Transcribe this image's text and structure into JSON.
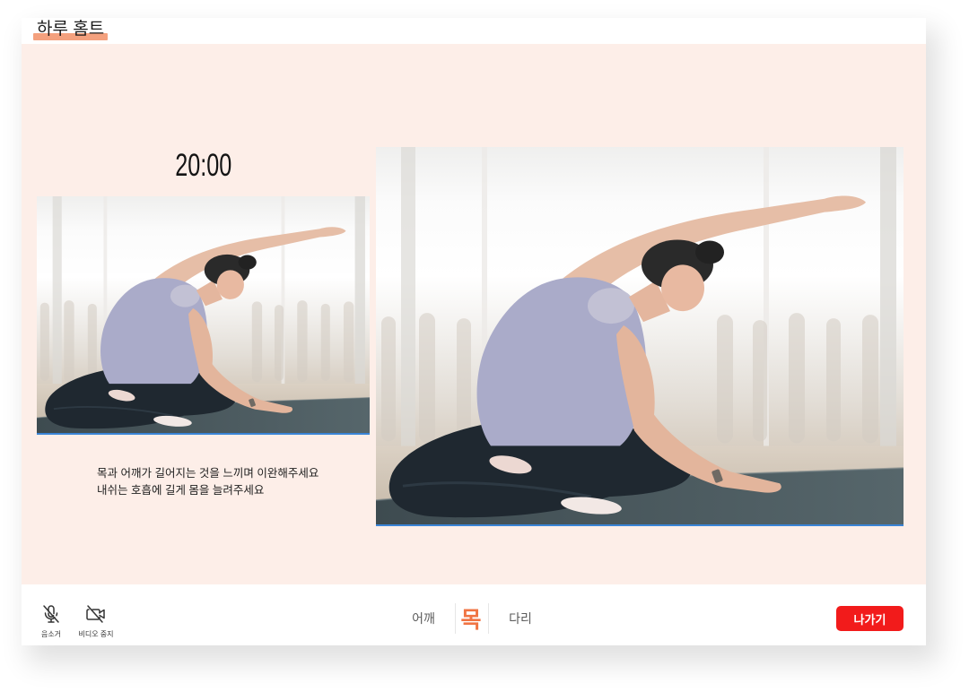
{
  "app": {
    "title": "하루 홈트"
  },
  "timer": {
    "remaining": "20:00"
  },
  "guide": {
    "instructions": [
      "목과 어깨가 길어지는 것을 느끼며 이완해주세요",
      "내쉬는 호흡에 길게 몸을 늘려주세요"
    ]
  },
  "controls": {
    "mute": {
      "label": "음소거",
      "icon": "mic-off-icon"
    },
    "video": {
      "label": "비디오 중지",
      "icon": "video-off-icon"
    }
  },
  "body_parts": {
    "items": [
      {
        "label": "어깨",
        "active": false
      },
      {
        "label": "목",
        "active": true
      },
      {
        "label": "다리",
        "active": false
      }
    ]
  },
  "exit_button": {
    "label": "나가기"
  },
  "colors": {
    "accent": "#f07443",
    "title_highlight": "#f4a17e",
    "stage_background": "#fdeee8",
    "exit_button": "#f21b1b",
    "video_underline": "#3a84d6"
  }
}
